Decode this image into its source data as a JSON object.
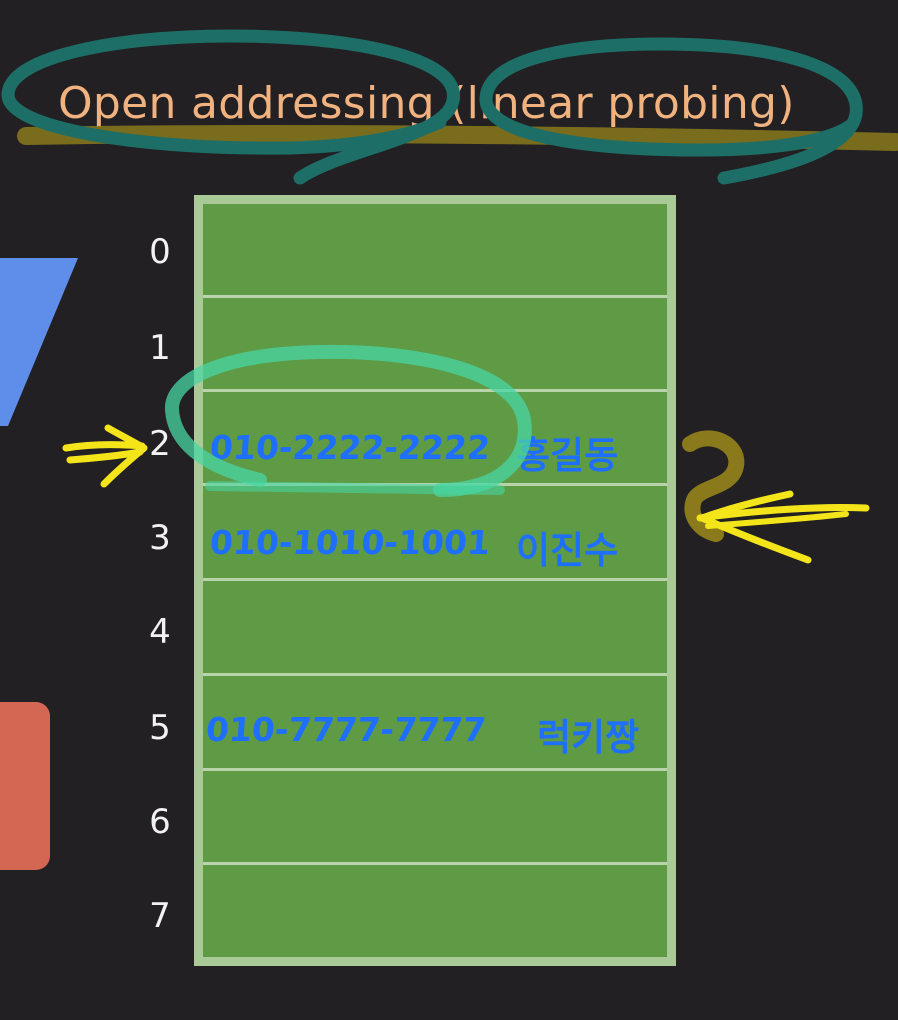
{
  "title": "Open addressing (linear probing)",
  "colors": {
    "background": "#222023",
    "title": "#f0b27e",
    "table_fill": "#5f9a45",
    "table_border": "#a9c997",
    "handwriting_blue": "#1f6fff",
    "annotation_teal": "#1d6e66",
    "annotation_green": "#48d6a4",
    "annotation_yellow": "#f4e51a",
    "annotation_olive": "#8a7a1c"
  },
  "table": {
    "slots": [
      {
        "index": "0",
        "phone": "",
        "name": ""
      },
      {
        "index": "1",
        "phone": "",
        "name": ""
      },
      {
        "index": "2",
        "phone": "010-2222-2222",
        "name": "홍길동"
      },
      {
        "index": "3",
        "phone": "010-1010-1001",
        "name": "이진수"
      },
      {
        "index": "4",
        "phone": "",
        "name": ""
      },
      {
        "index": "5",
        "phone": "010-7777-7777",
        "name": "럭키짱"
      },
      {
        "index": "6",
        "phone": "",
        "name": ""
      },
      {
        "index": "7",
        "phone": "",
        "name": ""
      }
    ]
  },
  "annotations": {
    "left_arrow_target": "2",
    "right_arrow_target": "3",
    "circled_slot": "2"
  }
}
